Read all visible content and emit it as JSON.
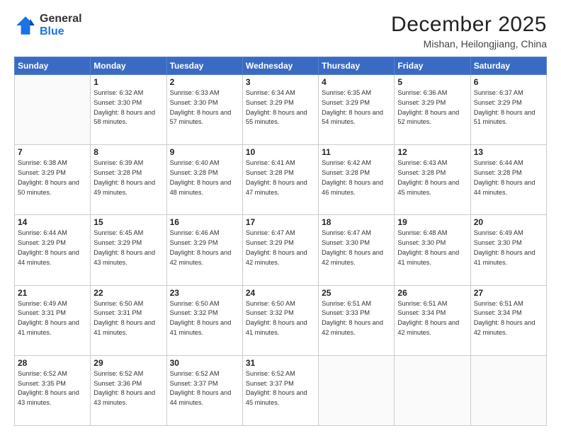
{
  "logo": {
    "line1": "General",
    "line2": "Blue"
  },
  "title": "December 2025",
  "location": "Mishan, Heilongjiang, China",
  "days_of_week": [
    "Sunday",
    "Monday",
    "Tuesday",
    "Wednesday",
    "Thursday",
    "Friday",
    "Saturday"
  ],
  "weeks": [
    [
      {
        "day": "",
        "sunrise": "",
        "sunset": "",
        "daylight": ""
      },
      {
        "day": "1",
        "sunrise": "Sunrise: 6:32 AM",
        "sunset": "Sunset: 3:30 PM",
        "daylight": "Daylight: 8 hours and 58 minutes."
      },
      {
        "day": "2",
        "sunrise": "Sunrise: 6:33 AM",
        "sunset": "Sunset: 3:30 PM",
        "daylight": "Daylight: 8 hours and 57 minutes."
      },
      {
        "day": "3",
        "sunrise": "Sunrise: 6:34 AM",
        "sunset": "Sunset: 3:29 PM",
        "daylight": "Daylight: 8 hours and 55 minutes."
      },
      {
        "day": "4",
        "sunrise": "Sunrise: 6:35 AM",
        "sunset": "Sunset: 3:29 PM",
        "daylight": "Daylight: 8 hours and 54 minutes."
      },
      {
        "day": "5",
        "sunrise": "Sunrise: 6:36 AM",
        "sunset": "Sunset: 3:29 PM",
        "daylight": "Daylight: 8 hours and 52 minutes."
      },
      {
        "day": "6",
        "sunrise": "Sunrise: 6:37 AM",
        "sunset": "Sunset: 3:29 PM",
        "daylight": "Daylight: 8 hours and 51 minutes."
      }
    ],
    [
      {
        "day": "7",
        "sunrise": "Sunrise: 6:38 AM",
        "sunset": "Sunset: 3:29 PM",
        "daylight": "Daylight: 8 hours and 50 minutes."
      },
      {
        "day": "8",
        "sunrise": "Sunrise: 6:39 AM",
        "sunset": "Sunset: 3:28 PM",
        "daylight": "Daylight: 8 hours and 49 minutes."
      },
      {
        "day": "9",
        "sunrise": "Sunrise: 6:40 AM",
        "sunset": "Sunset: 3:28 PM",
        "daylight": "Daylight: 8 hours and 48 minutes."
      },
      {
        "day": "10",
        "sunrise": "Sunrise: 6:41 AM",
        "sunset": "Sunset: 3:28 PM",
        "daylight": "Daylight: 8 hours and 47 minutes."
      },
      {
        "day": "11",
        "sunrise": "Sunrise: 6:42 AM",
        "sunset": "Sunset: 3:28 PM",
        "daylight": "Daylight: 8 hours and 46 minutes."
      },
      {
        "day": "12",
        "sunrise": "Sunrise: 6:43 AM",
        "sunset": "Sunset: 3:28 PM",
        "daylight": "Daylight: 8 hours and 45 minutes."
      },
      {
        "day": "13",
        "sunrise": "Sunrise: 6:44 AM",
        "sunset": "Sunset: 3:28 PM",
        "daylight": "Daylight: 8 hours and 44 minutes."
      }
    ],
    [
      {
        "day": "14",
        "sunrise": "Sunrise: 6:44 AM",
        "sunset": "Sunset: 3:29 PM",
        "daylight": "Daylight: 8 hours and 44 minutes."
      },
      {
        "day": "15",
        "sunrise": "Sunrise: 6:45 AM",
        "sunset": "Sunset: 3:29 PM",
        "daylight": "Daylight: 8 hours and 43 minutes."
      },
      {
        "day": "16",
        "sunrise": "Sunrise: 6:46 AM",
        "sunset": "Sunset: 3:29 PM",
        "daylight": "Daylight: 8 hours and 42 minutes."
      },
      {
        "day": "17",
        "sunrise": "Sunrise: 6:47 AM",
        "sunset": "Sunset: 3:29 PM",
        "daylight": "Daylight: 8 hours and 42 minutes."
      },
      {
        "day": "18",
        "sunrise": "Sunrise: 6:47 AM",
        "sunset": "Sunset: 3:30 PM",
        "daylight": "Daylight: 8 hours and 42 minutes."
      },
      {
        "day": "19",
        "sunrise": "Sunrise: 6:48 AM",
        "sunset": "Sunset: 3:30 PM",
        "daylight": "Daylight: 8 hours and 41 minutes."
      },
      {
        "day": "20",
        "sunrise": "Sunrise: 6:49 AM",
        "sunset": "Sunset: 3:30 PM",
        "daylight": "Daylight: 8 hours and 41 minutes."
      }
    ],
    [
      {
        "day": "21",
        "sunrise": "Sunrise: 6:49 AM",
        "sunset": "Sunset: 3:31 PM",
        "daylight": "Daylight: 8 hours and 41 minutes."
      },
      {
        "day": "22",
        "sunrise": "Sunrise: 6:50 AM",
        "sunset": "Sunset: 3:31 PM",
        "daylight": "Daylight: 8 hours and 41 minutes."
      },
      {
        "day": "23",
        "sunrise": "Sunrise: 6:50 AM",
        "sunset": "Sunset: 3:32 PM",
        "daylight": "Daylight: 8 hours and 41 minutes."
      },
      {
        "day": "24",
        "sunrise": "Sunrise: 6:50 AM",
        "sunset": "Sunset: 3:32 PM",
        "daylight": "Daylight: 8 hours and 41 minutes."
      },
      {
        "day": "25",
        "sunrise": "Sunrise: 6:51 AM",
        "sunset": "Sunset: 3:33 PM",
        "daylight": "Daylight: 8 hours and 42 minutes."
      },
      {
        "day": "26",
        "sunrise": "Sunrise: 6:51 AM",
        "sunset": "Sunset: 3:34 PM",
        "daylight": "Daylight: 8 hours and 42 minutes."
      },
      {
        "day": "27",
        "sunrise": "Sunrise: 6:51 AM",
        "sunset": "Sunset: 3:34 PM",
        "daylight": "Daylight: 8 hours and 42 minutes."
      }
    ],
    [
      {
        "day": "28",
        "sunrise": "Sunrise: 6:52 AM",
        "sunset": "Sunset: 3:35 PM",
        "daylight": "Daylight: 8 hours and 43 minutes."
      },
      {
        "day": "29",
        "sunrise": "Sunrise: 6:52 AM",
        "sunset": "Sunset: 3:36 PM",
        "daylight": "Daylight: 8 hours and 43 minutes."
      },
      {
        "day": "30",
        "sunrise": "Sunrise: 6:52 AM",
        "sunset": "Sunset: 3:37 PM",
        "daylight": "Daylight: 8 hours and 44 minutes."
      },
      {
        "day": "31",
        "sunrise": "Sunrise: 6:52 AM",
        "sunset": "Sunset: 3:37 PM",
        "daylight": "Daylight: 8 hours and 45 minutes."
      },
      {
        "day": "",
        "sunrise": "",
        "sunset": "",
        "daylight": ""
      },
      {
        "day": "",
        "sunrise": "",
        "sunset": "",
        "daylight": ""
      },
      {
        "day": "",
        "sunrise": "",
        "sunset": "",
        "daylight": ""
      }
    ]
  ]
}
